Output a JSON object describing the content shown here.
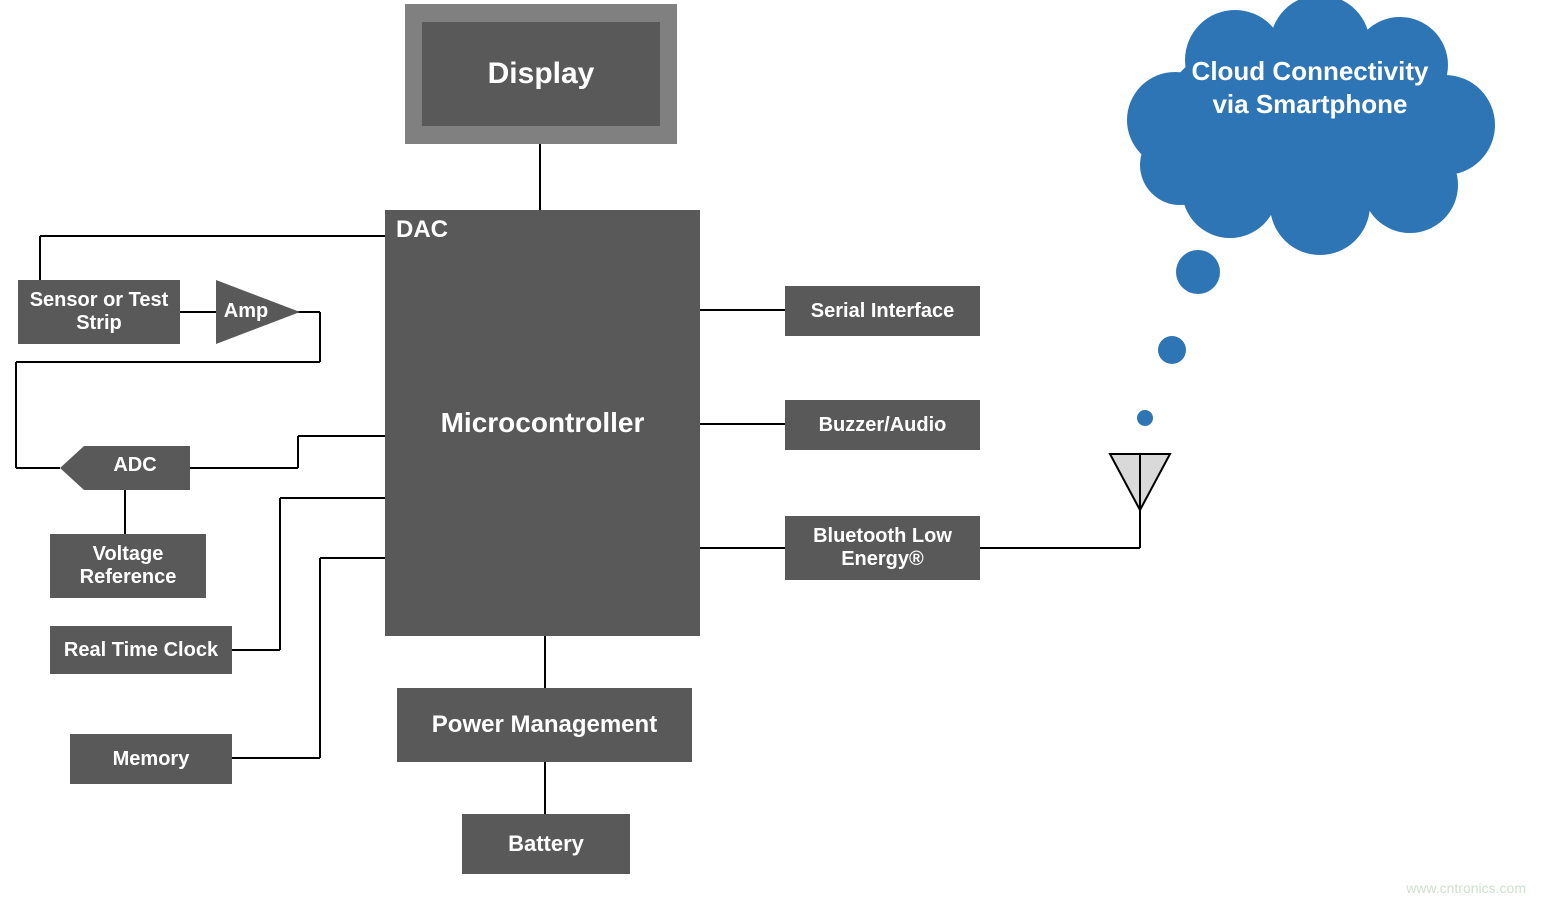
{
  "blocks": {
    "display": "Display",
    "microcontroller": "Microcontroller",
    "dac": "DAC",
    "sensor": "Sensor or Test Strip",
    "amp": "Amp",
    "adc": "ADC",
    "voltage_ref": "Voltage Reference",
    "rtc": "Real Time Clock",
    "memory": "Memory",
    "serial": "Serial Interface",
    "buzzer": "Buzzer/Audio",
    "ble": "Bluetooth Low Energy®",
    "power": "Power Management",
    "battery": "Battery"
  },
  "cloud": {
    "text": "Cloud Connectivity via Smartphone"
  },
  "watermark": "www.cntronics.com",
  "colors": {
    "block": "#595959",
    "display_border": "#808080",
    "cloud": "#2E75B6",
    "antenna_fill": "#D9D9D9",
    "line": "#000000"
  }
}
